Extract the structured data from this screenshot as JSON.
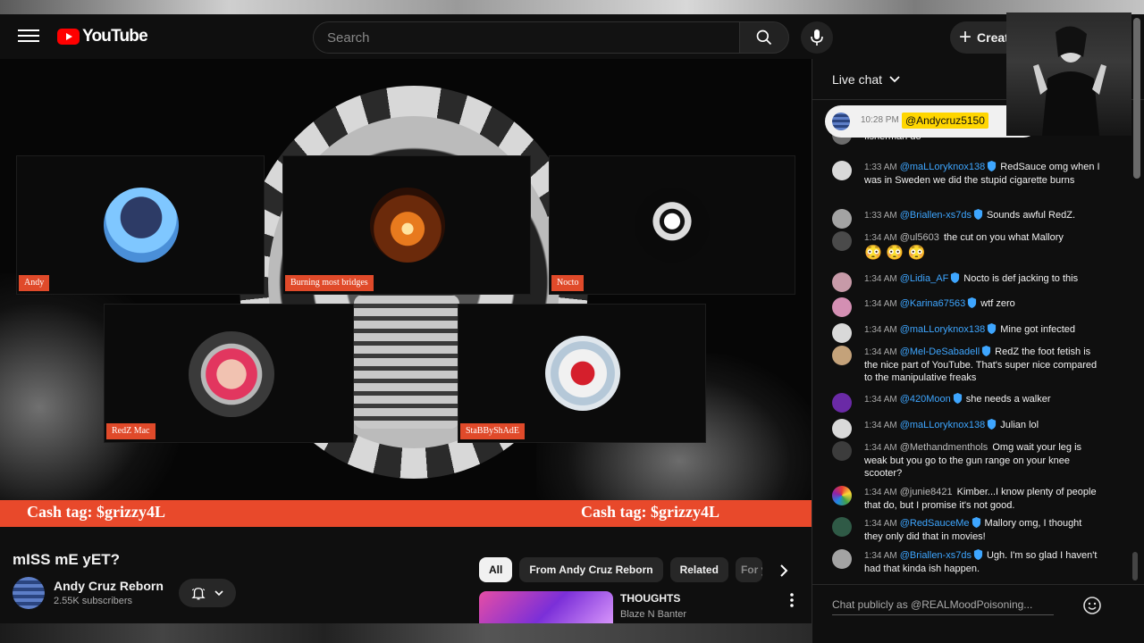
{
  "header": {
    "logo_text": "YouTube",
    "search_placeholder": "Search",
    "create_label": "Creat"
  },
  "video": {
    "panels": [
      {
        "name": "Andy"
      },
      {
        "name": "Burning most bridges"
      },
      {
        "name": "Nocto"
      },
      {
        "name": "RedZ Mac"
      },
      {
        "name": "StaBByShAdE"
      }
    ],
    "cash_tag_left": "Cash tag: $grizzy4L",
    "cash_tag_right": "Cash tag: $grizzy4L"
  },
  "below_video": {
    "title": "mISS mE yET?",
    "channel_name": "Andy Cruz  Reborn",
    "subscribers": "2.55K subscribers",
    "chips": [
      "All",
      "From Andy Cruz Reborn",
      "Related",
      "For y"
    ],
    "recommendation": {
      "title": "THOUGHTS",
      "channel": "Blaze N Banter"
    }
  },
  "chat": {
    "title": "Live chat",
    "pinned": {
      "time": "10:28 PM",
      "author": "@Andycruz5150",
      "link": "htt"
    },
    "partial_top": "fisherman do",
    "messages": [
      {
        "time": "1:33 AM",
        "author": "@maLLoryknox138",
        "text": "RedSauce omg when I was in Sweden we did the stupid cigarette burns"
      },
      {
        "time": "1:33 AM",
        "author": "@Briallen-xs7ds",
        "text": "Sounds awful RedZ."
      },
      {
        "time": "1:34 AM",
        "author": "@ul5603",
        "text": "the cut on you what Mallory"
      },
      {
        "time": "1:34 AM",
        "author": "@Lidia_AF",
        "text": "Nocto is def jacking to this"
      },
      {
        "time": "1:34 AM",
        "author": "@Karina67563",
        "text": "wtf zero"
      },
      {
        "time": "1:34 AM",
        "author": "@maLLoryknox138",
        "text": "Mine got infected"
      },
      {
        "time": "1:34 AM",
        "author": "@Mel-DeSabadell",
        "text": "RedZ the foot fetish is the nice part of YouTube. That's super nice compared to the manipulative freaks"
      },
      {
        "time": "1:34 AM",
        "author": "@420Moon",
        "text": "she needs a walker"
      },
      {
        "time": "1:34 AM",
        "author": "@maLLoryknox138",
        "text": "Julian lol"
      },
      {
        "time": "1:34 AM",
        "author": "@Methandmenthols",
        "text": "Omg wait your leg is weak but you go to the gun range on your knee scooter?"
      },
      {
        "time": "1:34 AM",
        "author": "@junie8421",
        "text": "Kimber...I know plenty of people that do, but I promise it's not good."
      },
      {
        "time": "1:34 AM",
        "author": "@RedSauceMe",
        "text": "Mallory omg, I thought they only did that in movies!"
      },
      {
        "time": "1:34 AM",
        "author": "@Briallen-xs7ds",
        "text": "Ugh. I'm so glad I haven't had that kinda ish happen."
      }
    ],
    "input_placeholder": "Chat publicly as @REALMoodPoisoning..."
  }
}
